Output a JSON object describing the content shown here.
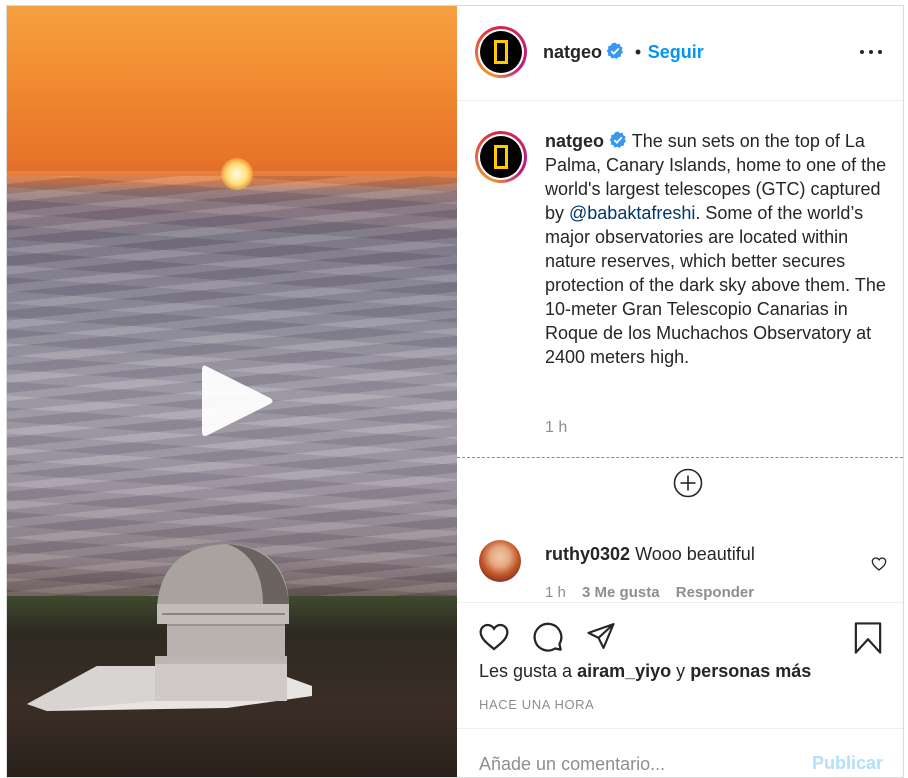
{
  "post": {
    "account": "natgeo",
    "follow_label": "Seguir",
    "separator": "•",
    "caption": {
      "username": "natgeo",
      "text_before_mention": "The sun sets on the top of La Palma, Canary Islands, home to one of the world's largest telescopes (GTC) captured by ",
      "mention": "@babaktafreshi",
      "text_after_mention": ". Some of the world’s major observatories are located within nature reserves, which better secures protection of the dark sky above them. The 10-meter Gran Telescopio Canarias in Roque de los Muchachos Observatory at 2400 meters high.",
      "time": "1 h"
    },
    "comment": {
      "username": "ruthy0302",
      "text": "Wooo beautiful",
      "time": "1 h",
      "likes": "3 Me gusta",
      "reply": "Responder"
    },
    "likes": {
      "prefix": "Les gusta a",
      "user": "airam_yiyo",
      "middle": "y",
      "others": "personas más"
    },
    "posted": "HACE UNA HORA",
    "add_comment": {
      "placeholder": "Añade un comentario...",
      "publish_label": "Publicar"
    }
  },
  "icons": {
    "avatar": "national-geographic-logo",
    "verified": "verified-badge-icon",
    "more": "more-options-icon",
    "play": "play-icon",
    "load_more": "plus-circle-icon",
    "like": "heart-icon",
    "comment": "comment-icon",
    "share": "send-icon",
    "save": "bookmark-icon"
  },
  "colors": {
    "follow": "#0095f6",
    "mention": "#00376b",
    "muted": "#8e8e8e",
    "publish_disabled": "#b2dffc",
    "verified": "#3897f0",
    "brand_yellow": "#ffcc00"
  }
}
